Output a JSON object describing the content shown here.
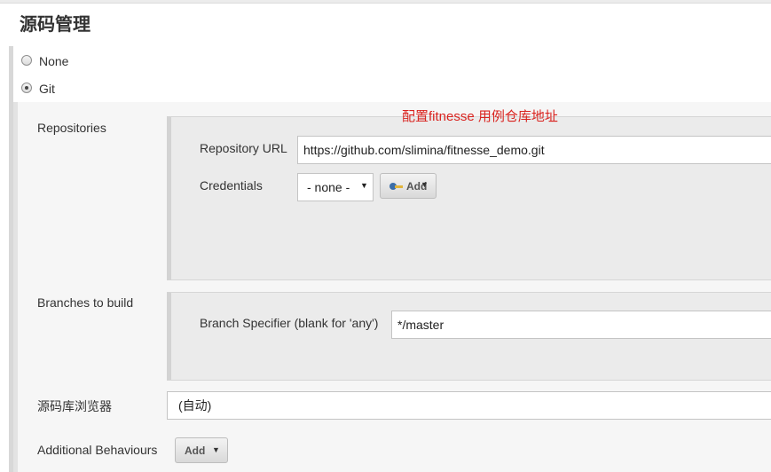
{
  "section": {
    "title": "源码管理"
  },
  "scm_options": [
    {
      "label": "None",
      "checked": false
    },
    {
      "label": "Git",
      "checked": true
    }
  ],
  "annotation": "配置fitnesse 用例仓库地址",
  "repositories": {
    "label": "Repositories",
    "repo_url_label": "Repository URL",
    "repo_url_value": "https://github.com/slimina/fitnesse_demo.git",
    "credentials_label": "Credentials",
    "credentials_value": "- none -",
    "add_button_label": "Add",
    "key_icon": "key-icon",
    "caret_icon": "caret-down-icon"
  },
  "branches": {
    "label": "Branches to build",
    "specifier_label": "Branch Specifier (blank for 'any')",
    "specifier_value": "*/master"
  },
  "repo_browser": {
    "label": "源码库浏览器",
    "value": "(自动)"
  },
  "behaviours": {
    "label": "Additional Behaviours",
    "add_button_label": "Add"
  },
  "colors": {
    "annotation": "#d9231f",
    "panel": "#ebebeb"
  }
}
